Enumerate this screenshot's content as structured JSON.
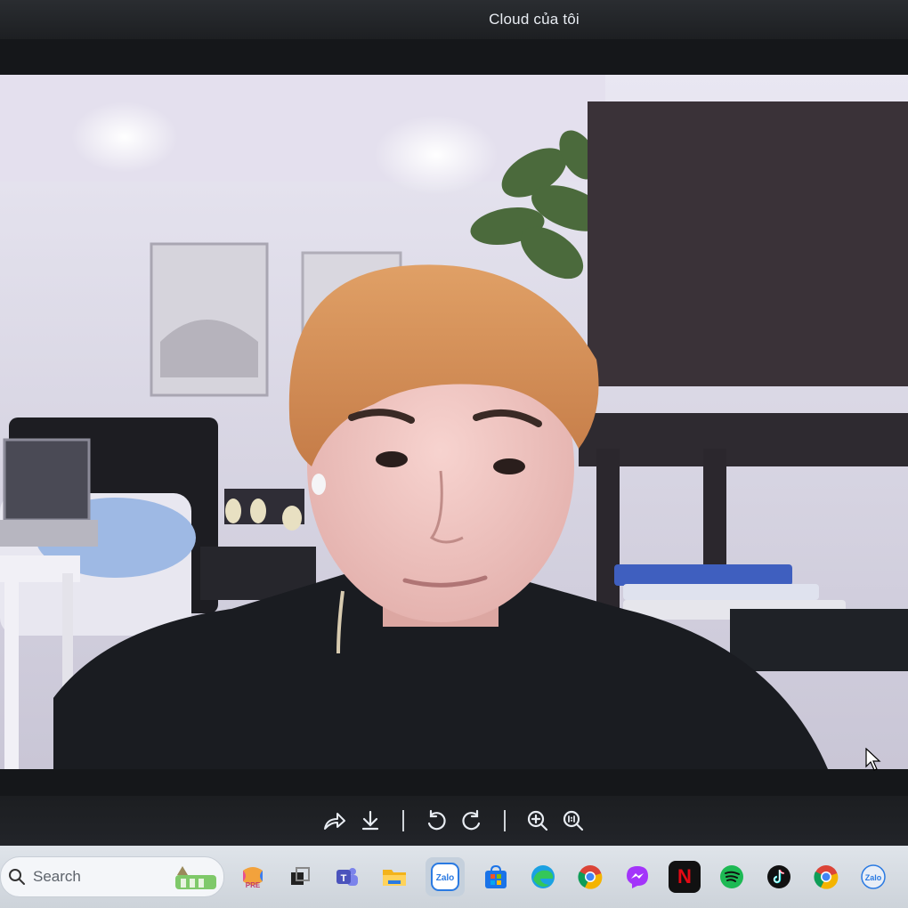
{
  "window": {
    "title": "Cloud của tôi"
  },
  "toolbar": {
    "buttons": [
      {
        "name": "share",
        "icon": "share-icon"
      },
      {
        "name": "download",
        "icon": "download-icon"
      },
      {
        "name": "rotate-left",
        "icon": "rotate-left-icon"
      },
      {
        "name": "rotate-right",
        "icon": "rotate-right-icon"
      },
      {
        "name": "zoom-in",
        "icon": "zoom-in-icon"
      },
      {
        "name": "actual-size",
        "icon": "zoom-1-1-icon"
      }
    ]
  },
  "taskbar": {
    "search": {
      "placeholder": "Search"
    },
    "apps": [
      {
        "name": "copilot",
        "icon": "copilot-icon",
        "badge": "PRE"
      },
      {
        "name": "task-view",
        "icon": "task-view-icon"
      },
      {
        "name": "teams",
        "icon": "teams-icon"
      },
      {
        "name": "file-explorer",
        "icon": "folder-icon"
      },
      {
        "name": "zalo",
        "icon": "zalo-icon",
        "label": "Zalo",
        "active": true
      },
      {
        "name": "microsoft-store",
        "icon": "store-icon"
      },
      {
        "name": "edge",
        "icon": "edge-icon"
      },
      {
        "name": "chrome",
        "icon": "chrome-icon"
      },
      {
        "name": "messenger",
        "icon": "messenger-icon"
      },
      {
        "name": "netflix",
        "icon": "netflix-icon",
        "label": "N"
      },
      {
        "name": "spotify",
        "icon": "spotify-icon"
      },
      {
        "name": "tiktok",
        "icon": "tiktok-icon"
      },
      {
        "name": "chrome-profile",
        "icon": "chrome-icon"
      },
      {
        "name": "zalo-2",
        "icon": "zalo-icon",
        "label": "Zalo"
      }
    ]
  },
  "colors": {
    "netflix": "#e50914",
    "spotify": "#1db954",
    "messenger": "#a334fa",
    "store": "#1a73e8"
  }
}
